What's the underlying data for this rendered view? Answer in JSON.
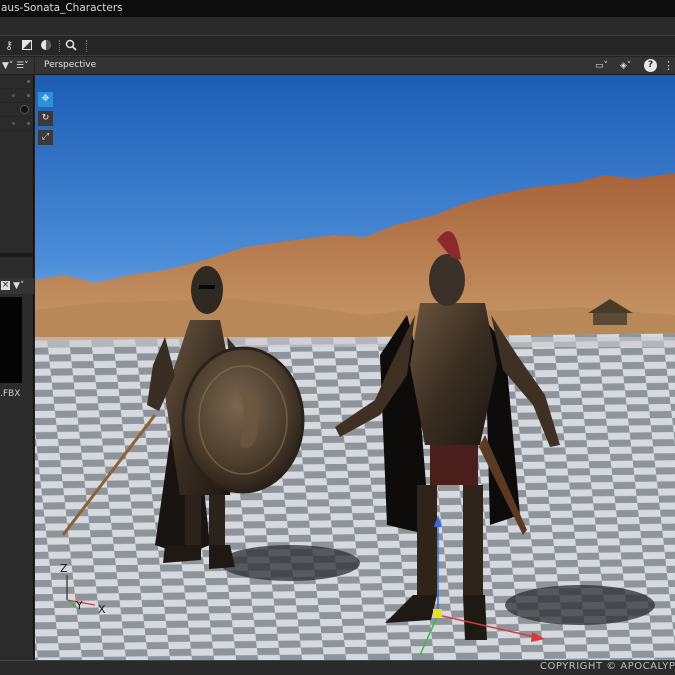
{
  "window": {
    "title": "aus-Sonata_Characters"
  },
  "viewport": {
    "label": "Perspective",
    "help_glyph": "?"
  },
  "scene": {
    "axis_labels": {
      "z": "Z",
      "y": "Y",
      "x": "X"
    }
  },
  "asset_panel": {
    "file_label": ".FBX"
  },
  "footer": {
    "copyright": "COPYRIGHT © APOCALYPS"
  },
  "colors": {
    "sky_top": "#1f5fb8",
    "sky_bottom": "#6fa7e0",
    "accent": "#2f8fd8",
    "axis_x": "#d83a3a",
    "axis_y": "#3ab84a",
    "axis_z": "#3a6ad8"
  },
  "icons": {
    "toolbar": [
      "key-select-icon",
      "image-icon",
      "sphere-icon",
      "zoom-icon"
    ],
    "viewport_tools": [
      "move-icon",
      "rotate-icon",
      "scale-icon"
    ],
    "header": [
      "camera-icon",
      "display-icon",
      "help-icon",
      "more-icon"
    ]
  }
}
